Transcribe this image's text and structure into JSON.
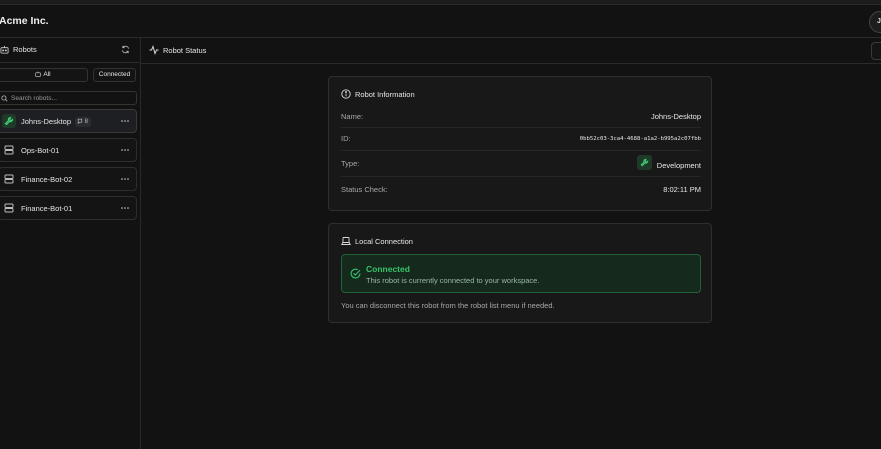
{
  "app": {
    "brand": "Acme Inc.",
    "avatar_initials": "JD"
  },
  "sidebar": {
    "title": "Robots",
    "filters": {
      "all": "All",
      "connected": "Connected"
    },
    "search_placeholder": "Search robots...",
    "robots": [
      {
        "name": "Johns-Desktop",
        "badge": "8",
        "active": true,
        "icon": "wrench-icon"
      },
      {
        "name": "Ops-Bot-01",
        "active": false,
        "icon": "server-icon"
      },
      {
        "name": "Finance-Bot-02",
        "active": false,
        "icon": "server-icon"
      },
      {
        "name": "Finance-Bot-01",
        "active": false,
        "icon": "server-icon"
      }
    ]
  },
  "main": {
    "title": "Robot Status",
    "info_card": {
      "title": "Robot Information",
      "name_label": "Name:",
      "name_value": "Johns-Desktop",
      "id_label": "ID:",
      "id_value": "0bb52c03-3ca4-4688-a1a2-b995a2c07fbb",
      "type_label": "Type:",
      "type_value": "Development",
      "status_label": "Status Check:",
      "status_value": "8:02:11 PM"
    },
    "connection_card": {
      "title": "Local Connection",
      "status_title": "Connected",
      "status_desc": "This robot is currently connected to your workspace.",
      "note": "You can disconnect this robot from the robot list menu if needed."
    }
  },
  "colors": {
    "accent_green": "#36c26a",
    "background": "#121212",
    "card": "#181818"
  }
}
